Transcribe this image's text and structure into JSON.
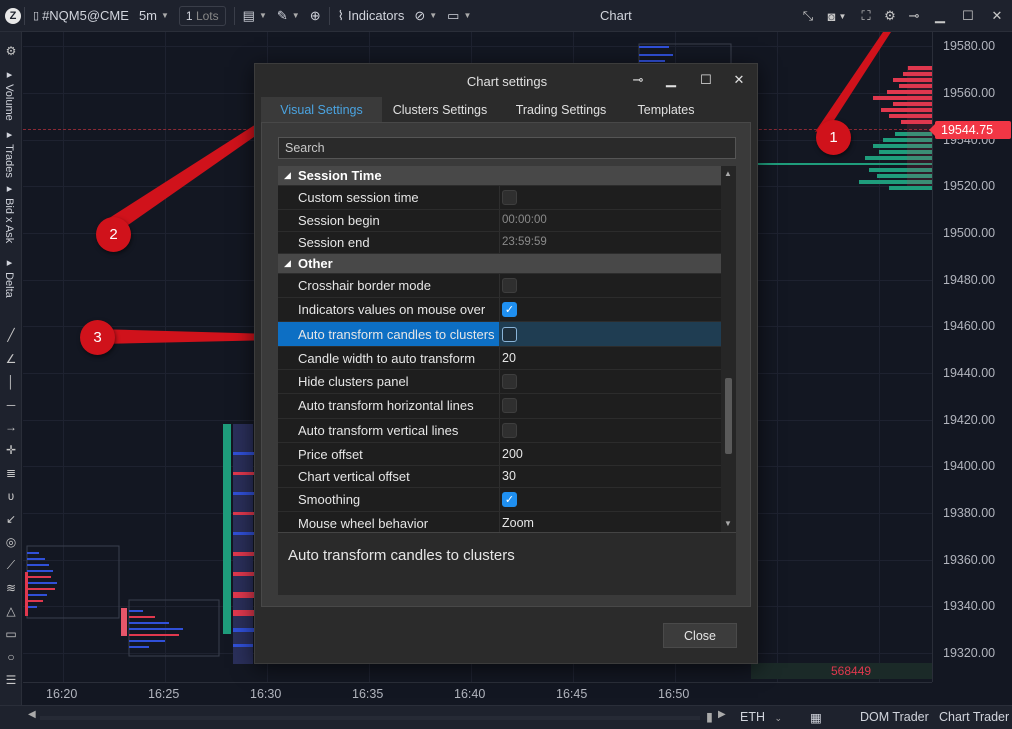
{
  "topbar": {
    "symbol": "#NQM5@CME",
    "timeframe": "5m",
    "lots_value": "1",
    "lots_unit": "Lots",
    "indicators_label": "Indicators",
    "window_title": "Chart"
  },
  "leftbar": {
    "panels": [
      "Volume",
      "Trades",
      "Bid x Ask",
      "Delta"
    ]
  },
  "price_axis": {
    "labels": [
      "19580.00",
      "19560.00",
      "19540.00",
      "19520.00",
      "19500.00",
      "19480.00",
      "19460.00",
      "19440.00",
      "19420.00",
      "19400.00",
      "19380.00",
      "19360.00",
      "19340.00",
      "19320.00"
    ],
    "current_price": "19544.75"
  },
  "time_axis": {
    "labels": [
      "16:20",
      "16:25",
      "16:30",
      "16:35",
      "16:40",
      "16:45",
      "16:50"
    ]
  },
  "chart": {
    "volume_readout": "568449",
    "colors": {
      "bid": "#e0384e",
      "ask": "#1f9d7c",
      "blue": "#3050d8"
    }
  },
  "bottombar": {
    "session": "ETH",
    "dom_trader": "DOM Trader",
    "chart_trader": "Chart Trader"
  },
  "dialog": {
    "title": "Chart settings",
    "tabs": [
      "Visual Settings",
      "Clusters Settings",
      "Trading Settings",
      "Templates"
    ],
    "active_tab": "Visual Settings",
    "search_placeholder": "Search",
    "session_time": {
      "header": "Session Time",
      "custom_session_time": "Custom session time",
      "session_begin": "Session begin",
      "session_begin_value": "00:00:00",
      "session_end": "Session end",
      "session_end_value": "23:59:59"
    },
    "other": {
      "header": "Other",
      "crosshair_border_mode": "Crosshair border mode",
      "indicators_values": "Indicators values on mouse over",
      "auto_transform_candles": "Auto transform candles to clusters",
      "candle_width": "Candle width to auto transform",
      "candle_width_value": "20",
      "hide_clusters_panel": "Hide clusters panel",
      "auto_transform_horizontal": "Auto transform horizontal lines",
      "auto_transform_vertical": "Auto transform vertical lines",
      "price_offset": "Price offset",
      "price_offset_value": "200",
      "chart_vertical_offset": "Chart vertical offset",
      "chart_vertical_offset_value": "30",
      "smoothing": "Smoothing",
      "mouse_wheel": "Mouse wheel behavior",
      "mouse_wheel_value": "Zoom"
    },
    "description": "Auto transform candles to clusters",
    "close_label": "Close"
  },
  "callouts": [
    "1",
    "2",
    "3"
  ]
}
